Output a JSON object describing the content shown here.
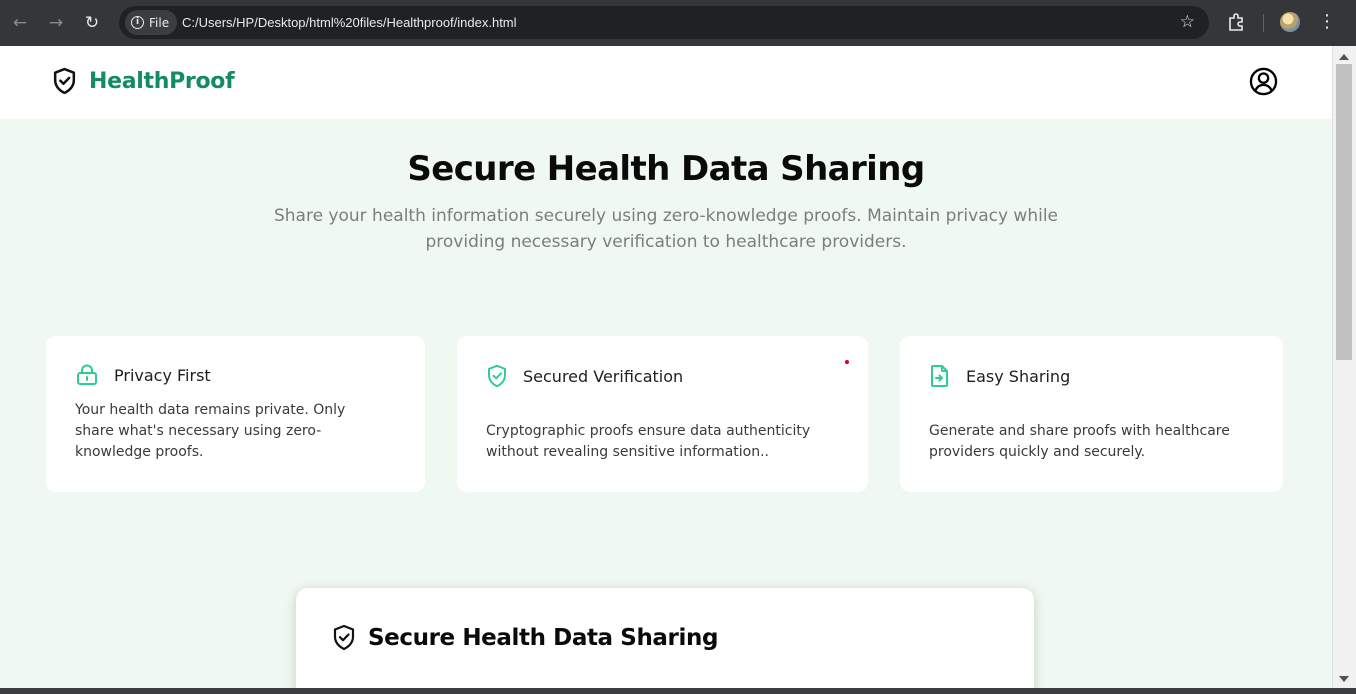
{
  "browser": {
    "back_icon": "arrow-left-icon",
    "forward_icon": "arrow-right-icon",
    "reload_icon": "reload-icon",
    "security_chip_label": "File",
    "url": "C:/Users/HP/Desktop/html%20files/Healthproof/index.html",
    "bookmark_icon": "star-icon",
    "extensions_icon": "puzzle-icon",
    "menu_icon": "kebab-menu-icon"
  },
  "header": {
    "brand": "HealthProof",
    "logo_icon": "shield-check-icon",
    "account_icon": "user-circle-icon"
  },
  "hero": {
    "title": "Secure Health Data Sharing",
    "subtitle_line1": "Share your health information securely using zero-knowledge proofs. Maintain privacy while",
    "subtitle_line2": "providing necessary verification to healthcare providers."
  },
  "features": [
    {
      "icon": "lock-icon",
      "title": "Privacy First",
      "lines": [
        "Your health data remains private. Only",
        "share what's necessary using zero-",
        "knowledge proofs."
      ]
    },
    {
      "icon": "shield-check-icon",
      "title": "Secured Verification",
      "lines": [
        "Cryptographic proofs ensure data authenticity",
        "without revealing sensitive information.."
      ]
    },
    {
      "icon": "file-share-icon",
      "title": "Easy Sharing",
      "lines": [
        "Generate and share proofs with healthcare",
        "providers quickly and securely."
      ]
    }
  ],
  "sharing_panel": {
    "icon": "shield-check-icon",
    "title": "Secure Health Data Sharing"
  },
  "colors": {
    "brand": "#148c63",
    "accent_icon": "#2ecc8f",
    "page_background": "#f0f9f1"
  }
}
